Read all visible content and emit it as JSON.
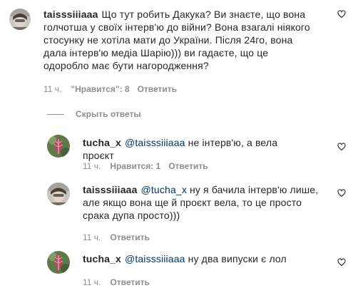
{
  "comments": [
    {
      "username": "taisssiiiaaa",
      "mention": "",
      "text": "Що тут робить Дакука? Ви знаєте, що вона голчотша у своїх інтерв'ю до війни? Вона взагалі ніякого стосунку не хотіла мати до України. Після 24го, вона дала інтерв'ю медіа Шарію))) ви гадаєте, що це одоробло має бути нагородження?",
      "time": "11 ч.",
      "likes": "\"Нравится\": 8",
      "reply": "Ответить"
    },
    {
      "username": "tucha_x",
      "mention": "@taisssiiiaaa",
      "text": "не інтерв'ю, а вела проєкт",
      "time": "11 ч.",
      "likes": "Нравится: 1",
      "reply": "Ответить"
    },
    {
      "username": "taisssiiiaaa",
      "mention": "@tucha_x",
      "text": "ну я бачила інтерв'ю лише, але якщо вона ще й проєкт вела, то це просто срака дупа просто)))",
      "time": "11 ч.",
      "likes": "",
      "reply": "Ответить"
    },
    {
      "username": "tucha_x",
      "mention": "@taisssiiiaaa",
      "text": "ну два випуски є лол",
      "time": "11 ч.",
      "likes": "",
      "reply": "Ответить"
    }
  ],
  "hide_replies": "Скрыть ответы",
  "colors": {
    "text": "#262626",
    "secondary": "#8e8e8e",
    "mention": "#00376b"
  },
  "icons": [
    "heart-outline-icon"
  ]
}
